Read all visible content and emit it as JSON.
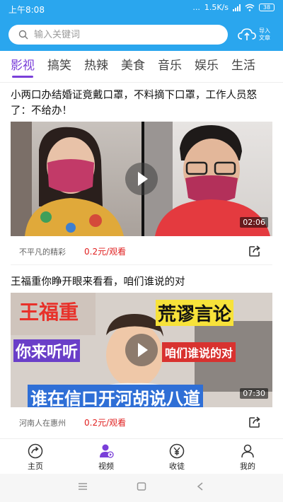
{
  "status_bar": {
    "time": "上午8:08",
    "dots": "...",
    "net_speed": "1.5K/s",
    "battery": "38"
  },
  "search": {
    "placeholder": "输入关键词"
  },
  "import": {
    "label": "导入文章"
  },
  "tabs": [
    "影视",
    "搞笑",
    "热辣",
    "美食",
    "音乐",
    "娱乐",
    "生活"
  ],
  "videos": [
    {
      "title": "小两口办结婚证竟戴口罩，不料摘下口罩，工作人员怒了：不给办！",
      "duration": "02:06",
      "author": "不平凡的精彩",
      "price": "0.2元/观看"
    },
    {
      "title": "王福重你睁开眼来看看，咱们谁说的对",
      "duration": "07:30",
      "author": "河南人在惠州",
      "price": "0.2元/观看",
      "captions": {
        "top_left": "王福重",
        "top_right": "荒谬言论",
        "mid_left": "你来听听",
        "mid_right": "咱们谁说的对",
        "bottom": "谁在信口开河胡说八道"
      }
    }
  ],
  "bottom_nav": [
    {
      "label": "主页",
      "icon": "share-circle-icon"
    },
    {
      "label": "视频",
      "icon": "user-video-icon"
    },
    {
      "label": "收徒",
      "icon": "yen-coin-icon"
    },
    {
      "label": "我的",
      "icon": "person-icon"
    }
  ],
  "colors": {
    "header_bg": "#2aa6ee",
    "accent": "#7a3fd9",
    "price": "#e02020"
  }
}
